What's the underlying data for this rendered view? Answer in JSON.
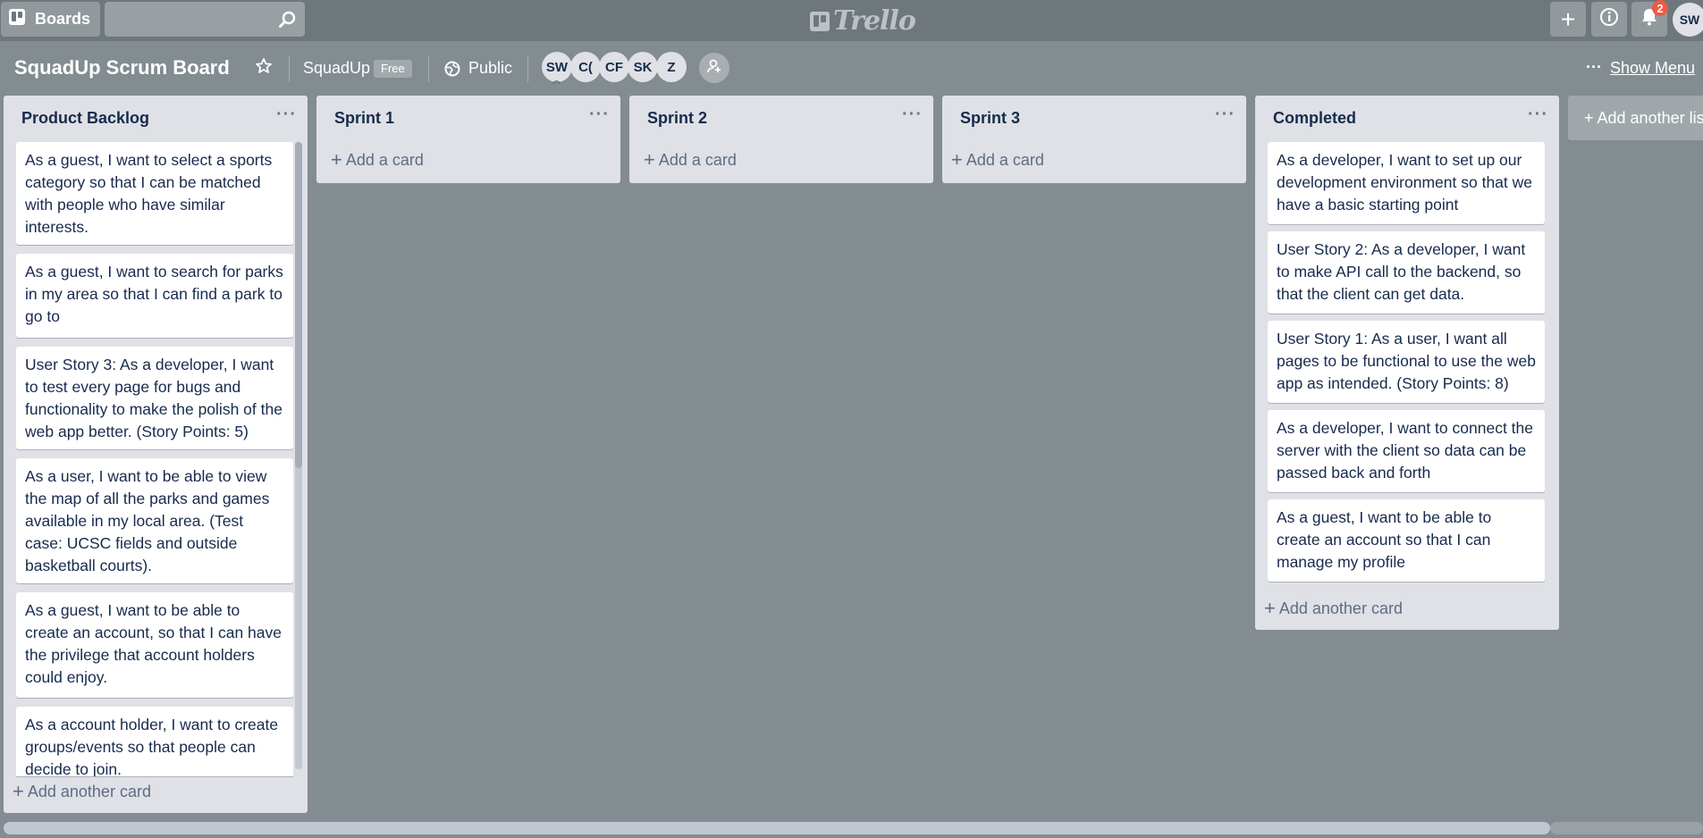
{
  "header": {
    "boards_label": "Boards",
    "search_value": "",
    "logo_text": "Trello",
    "notification_count": "2",
    "user_initials": "SW"
  },
  "board": {
    "title": "SquadUp Scrum Board",
    "team_name": "SquadUp",
    "plan_badge": "Free",
    "visibility": "Public",
    "members": [
      "SW",
      "C(",
      "CF",
      "SK",
      "Z"
    ],
    "menu_dots": "···",
    "show_menu_label": "Show Menu",
    "add_list_label": "+ Add another list"
  },
  "lists": [
    {
      "title": "Product Backlog",
      "menu": "···",
      "add_label": "Add another card",
      "cards": [
        "As a guest, I want to select a sports category so that I can be matched with people who have similar interests.",
        "As a guest, I want to search for parks in my area so that I can find a park to go to",
        "User Story 3: As a developer, I want to test every page for bugs and functionality to make the polish of the web app better. (Story Points: 5)",
        "As a user, I want to be able to view the map of all the parks and games available in my local area. (Test case: UCSC fields and outside basketball courts).",
        "As a guest, I want to be able to create an account, so that I can have the privilege that account holders could enjoy.",
        "As a account holder, I want to create groups/events so that people can decide to join."
      ]
    },
    {
      "title": "Sprint 1",
      "menu": "···",
      "add_label": "Add a card",
      "cards": []
    },
    {
      "title": "Sprint 2",
      "menu": "···",
      "add_label": "Add a card",
      "cards": []
    },
    {
      "title": "Sprint 3",
      "menu": "···",
      "add_label": "Add a card",
      "cards": []
    },
    {
      "title": "Completed",
      "menu": "···",
      "add_label": "Add another card",
      "cards": [
        "As a developer, I want to set up our development environment so that we have a basic starting point",
        "User Story 2: As a developer, I want to make API call to the backend, so that the client can get data.",
        "User Story 1: As a user, I want all pages to be functional to use the web app as intended. (Story Points: 8)",
        "As a developer, I want to connect the server with the client so data can be passed back and forth",
        "As a guest, I want to be able to create an account so that I can manage my profile"
      ]
    }
  ]
}
